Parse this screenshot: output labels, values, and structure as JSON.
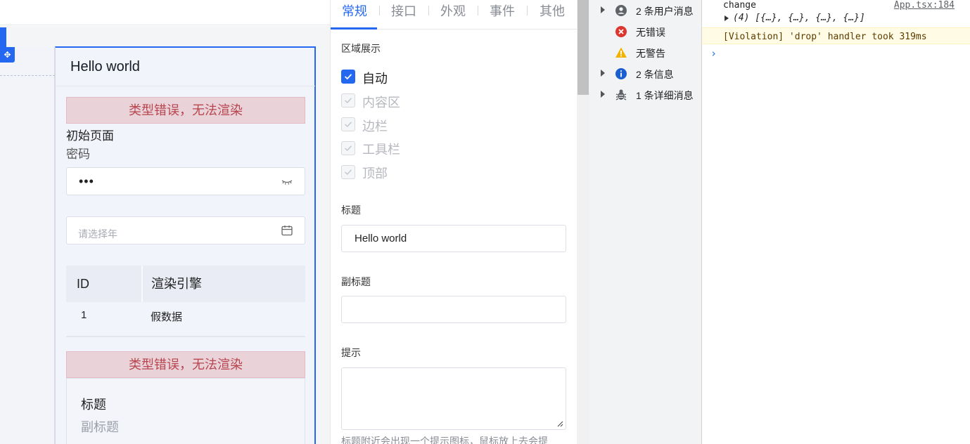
{
  "canvas": {
    "page_title": "Hello world",
    "error_message_1": "类型错误，无法渲染",
    "error_message_2": "类型错误，无法渲染",
    "initial_page_text": "初始页面",
    "password_label": "密码",
    "password_value": "•••",
    "year_placeholder": "请选择年",
    "table": {
      "headers": [
        "ID",
        "渲染引擎"
      ],
      "rows": [
        [
          "1",
          "假数据"
        ]
      ]
    },
    "card": {
      "title": "标题",
      "subtitle": "副标题"
    }
  },
  "panel": {
    "tabs": [
      {
        "label": "常规",
        "active": true
      },
      {
        "label": "接口",
        "active": false
      },
      {
        "label": "外观",
        "active": false
      },
      {
        "label": "事件",
        "active": false
      },
      {
        "label": "其他",
        "active": false
      }
    ],
    "region_label": "区域展示",
    "checkboxes": [
      {
        "label": "自动",
        "checked": true,
        "disabled": false
      },
      {
        "label": "内容区",
        "checked": true,
        "disabled": true
      },
      {
        "label": "边栏",
        "checked": true,
        "disabled": true
      },
      {
        "label": "工具栏",
        "checked": true,
        "disabled": true
      },
      {
        "label": "顶部",
        "checked": true,
        "disabled": true
      }
    ],
    "title_label": "标题",
    "title_value": "Hello world",
    "subtitle_label": "副标题",
    "subtitle_value": "",
    "hint_label": "提示",
    "hint_value": "",
    "hint_help": "标题附近会出现一个提示图标，鼠标放上去会提"
  },
  "devtools_sidebar": {
    "items": [
      {
        "label": "2 条用户消息",
        "icon": "user-icon",
        "expandable": true
      },
      {
        "label": "无错误",
        "icon": "error-icon",
        "expandable": false
      },
      {
        "label": "无警告",
        "icon": "warning-icon",
        "expandable": false
      },
      {
        "label": "2 条信息",
        "icon": "info-icon",
        "expandable": true
      },
      {
        "label": "1 条详细消息",
        "icon": "bug-icon",
        "expandable": true
      }
    ]
  },
  "console": {
    "log_text": "change",
    "source": "App.tsx:184",
    "array_preview": "(4) [{…}, {…}, {…}, {…}]",
    "violation": "[Violation] 'drop' handler took 319ms",
    "prompt": "›"
  },
  "colors": {
    "accent": "#2468f2",
    "error_bg": "#e9d3d8",
    "error_text": "#b8454f",
    "warning_bg": "#fffbe5"
  }
}
